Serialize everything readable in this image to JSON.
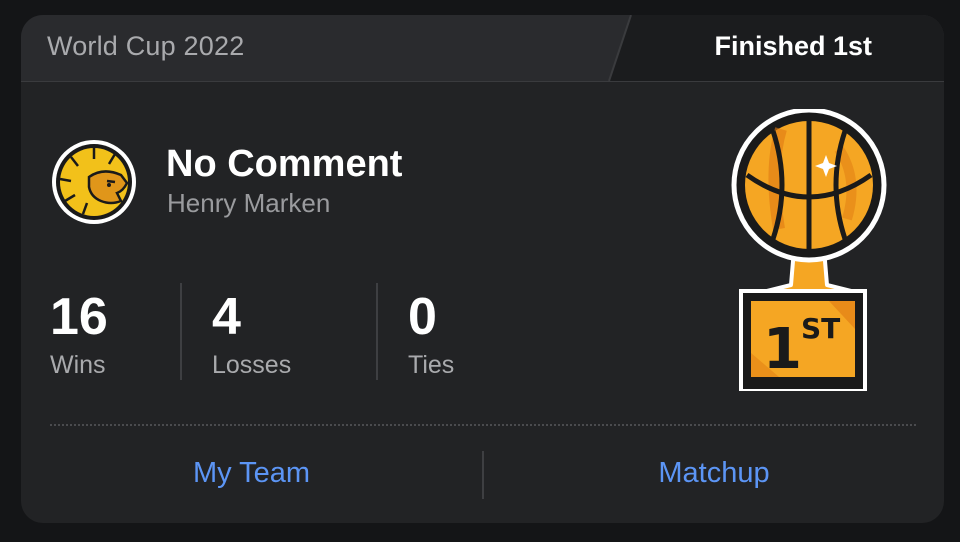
{
  "header": {
    "event_title": "World Cup 2022",
    "finish_label": "Finished 1st"
  },
  "team": {
    "name": "No Comment",
    "owner": "Henry Marken",
    "avatar_icon": "lion-icon"
  },
  "stats": [
    {
      "value": "16",
      "label": "Wins"
    },
    {
      "value": "4",
      "label": "Losses"
    },
    {
      "value": "0",
      "label": "Ties"
    }
  ],
  "trophy": {
    "icon": "basketball-trophy-icon",
    "placement": "1",
    "suffix": "ST"
  },
  "actions": {
    "my_team": "My Team",
    "matchup": "Matchup"
  },
  "colors": {
    "accent": "#5c95f5",
    "trophy_orange": "#f5a623",
    "card_bg": "#222325"
  }
}
